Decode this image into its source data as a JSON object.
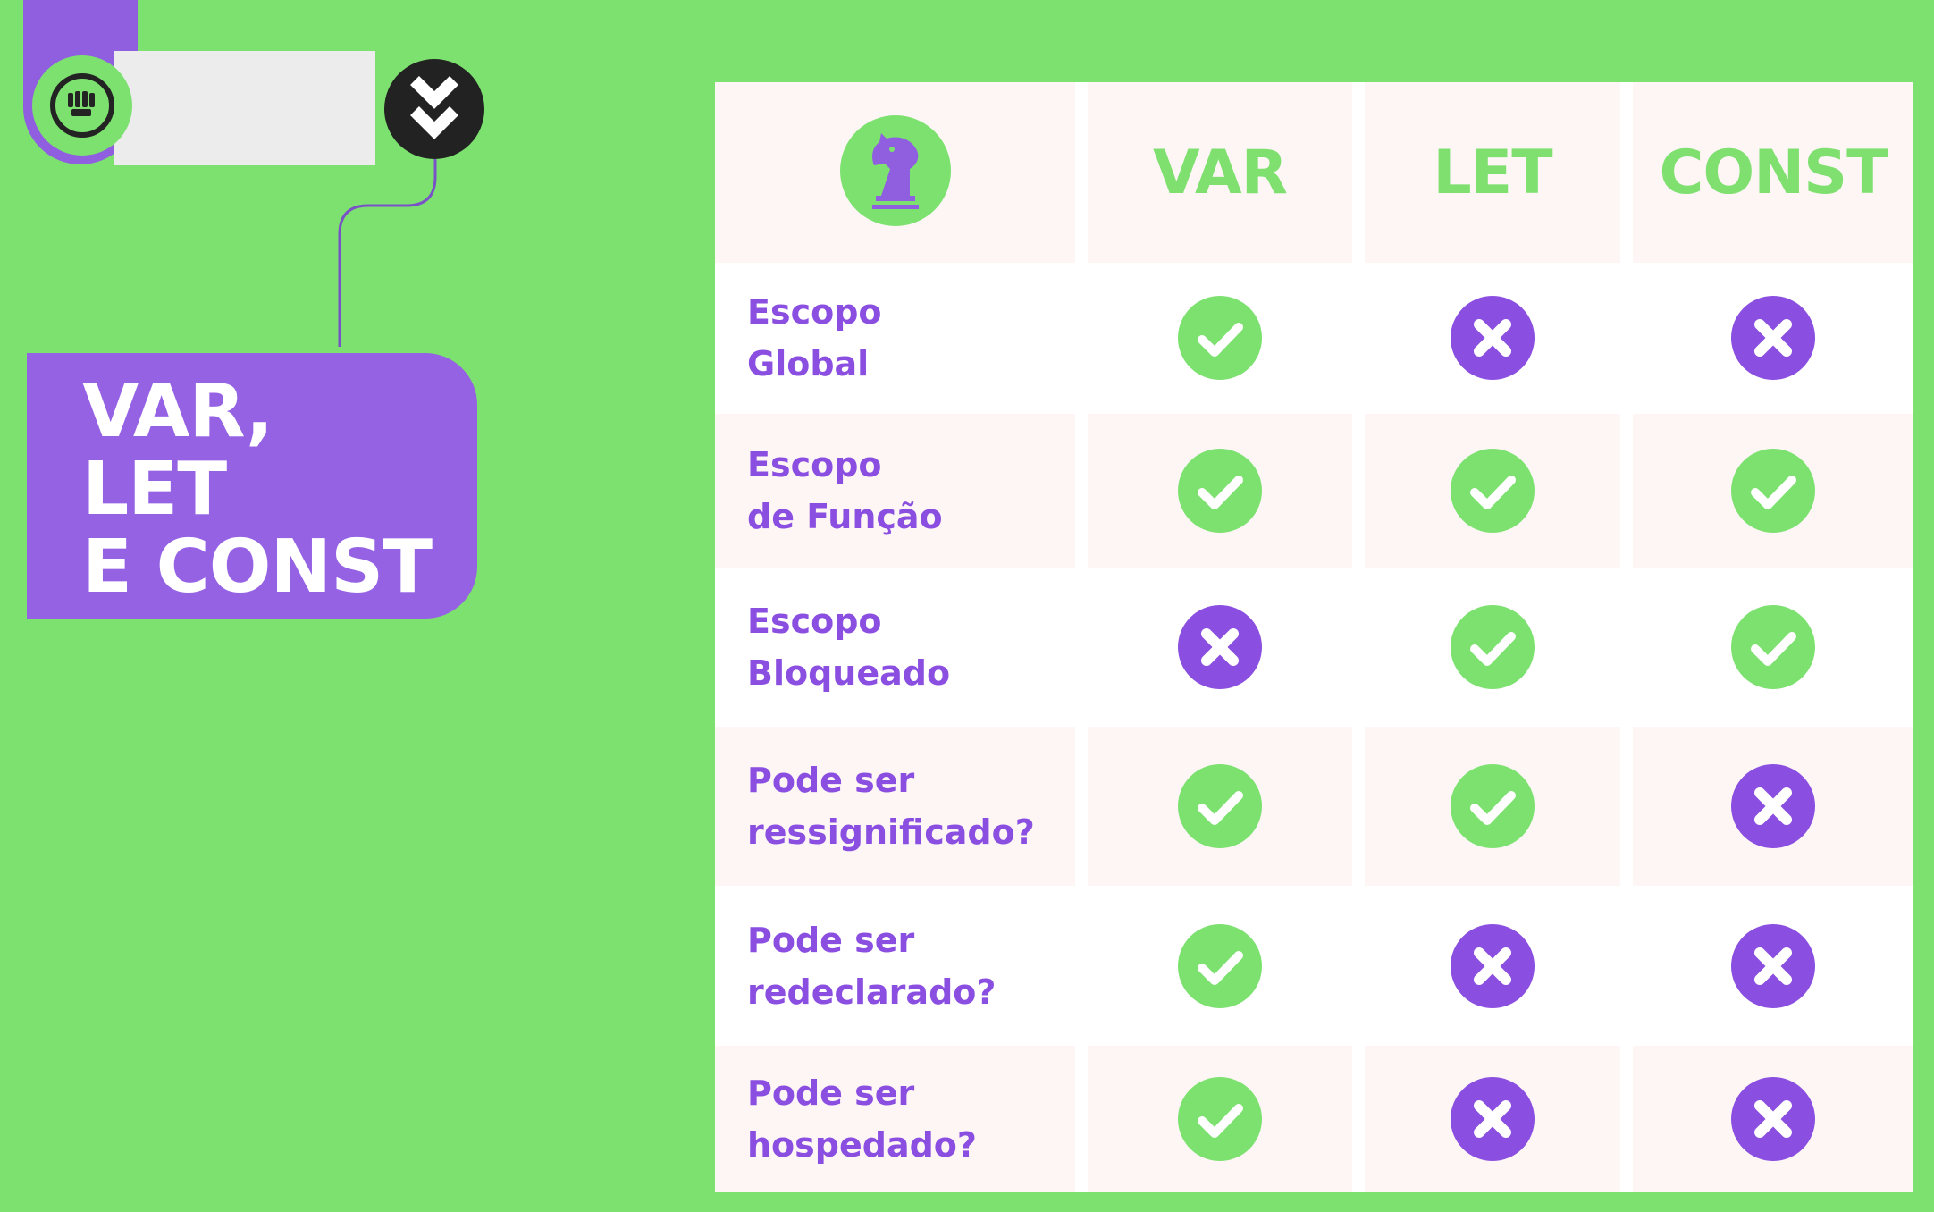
{
  "colors": {
    "background": "#7ce16f",
    "accent_purple": "#9562e4",
    "check_green": "#7ce16f",
    "cross_purple": "#8a4ee0",
    "header_green": "#7fe070"
  },
  "logo": {
    "icon": "fist-icon",
    "button_icon": "double-chevron-down-icon"
  },
  "title": {
    "line1": "VAR,",
    "line2": "LET",
    "line3": "E CONST"
  },
  "table": {
    "corner_icon": "chess-knight-icon",
    "columns": [
      "VAR",
      "LET",
      "CONST"
    ],
    "rows": [
      {
        "label_line1": "Escopo",
        "label_line2": "Global",
        "values": [
          "check",
          "cross",
          "cross"
        ]
      },
      {
        "label_line1": "Escopo",
        "label_line2": "de Função",
        "values": [
          "check",
          "check",
          "check"
        ]
      },
      {
        "label_line1": "Escopo",
        "label_line2": "Bloqueado",
        "values": [
          "cross",
          "check",
          "check"
        ]
      },
      {
        "label_line1": "Pode ser",
        "label_line2": "ressignificado?",
        "values": [
          "check",
          "check",
          "cross"
        ]
      },
      {
        "label_line1": "Pode ser",
        "label_line2": "redeclarado?",
        "values": [
          "check",
          "cross",
          "cross"
        ]
      },
      {
        "label_line1": "Pode ser",
        "label_line2": "hospedado?",
        "values": [
          "check",
          "cross",
          "cross"
        ]
      }
    ]
  }
}
